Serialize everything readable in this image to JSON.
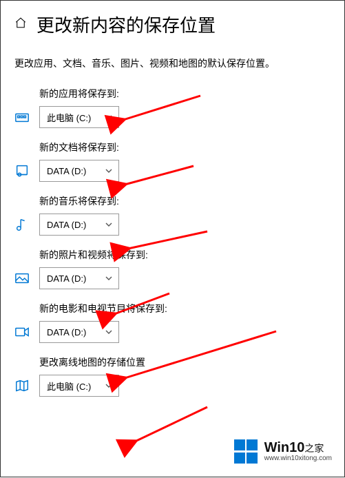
{
  "header": {
    "title": "更改新内容的保存位置"
  },
  "subtitle": "更改应用、文档、音乐、图片、视频和地图的默认保存位置。",
  "settings": [
    {
      "label": "新的应用将保存到:",
      "value": "此电脑 (C:)",
      "icon": "apps"
    },
    {
      "label": "新的文档将保存到:",
      "value": "DATA (D:)",
      "icon": "documents"
    },
    {
      "label": "新的音乐将保存到:",
      "value": "DATA (D:)",
      "icon": "music"
    },
    {
      "label": "新的照片和视频将保存到:",
      "value": "DATA (D:)",
      "icon": "photos"
    },
    {
      "label": "新的电影和电视节目将保存到:",
      "value": "DATA (D:)",
      "icon": "movies"
    },
    {
      "label": "更改离线地图的存储位置",
      "value": "此电脑 (C:)",
      "icon": "maps"
    }
  ],
  "watermark": {
    "brand_main": "Win10",
    "brand_sub": "之家",
    "url": "www.win10xitong.com"
  },
  "colors": {
    "accent": "#0078d4",
    "arrow": "#ff0000"
  }
}
